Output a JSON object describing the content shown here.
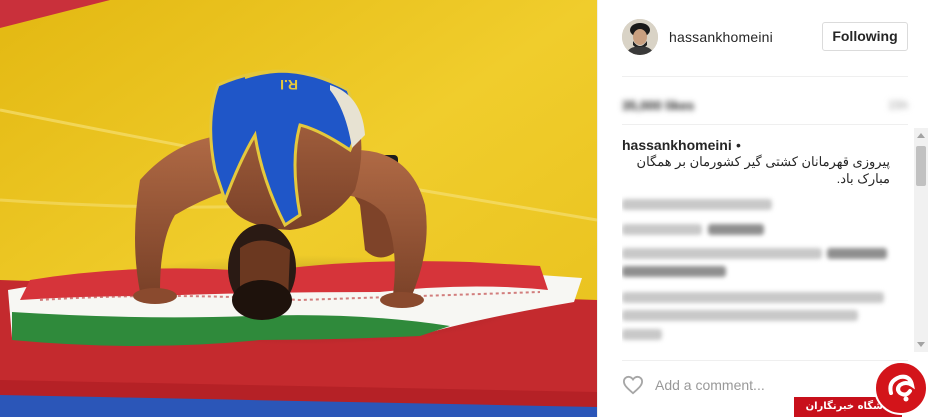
{
  "post": {
    "username": "hassankhomeini",
    "follow_label": "Following",
    "likes": "35,000 likes",
    "time": "15h",
    "caption_user": "hassankhomeini",
    "caption_dot": "•",
    "caption_text": "پیروزی قهرمانان کشتی گیر کشورمان بر همگان مبارک باد."
  },
  "comment_box": {
    "placeholder": "Add a comment..."
  },
  "photo": {
    "singlet_text": "I.R.IRAN"
  },
  "watermark": {
    "text": "باشگاه خبرنگاران"
  },
  "colors": {
    "mat_yellow": "#e9c21a",
    "mat_red": "#c92a2a",
    "singlet_blue": "#1f56c8",
    "flag_green": "#2f8a3b",
    "flag_red": "#d6343a",
    "watermark_red": "#d3141a"
  },
  "icons": {
    "heart": "heart-icon",
    "avatar": "avatar"
  }
}
